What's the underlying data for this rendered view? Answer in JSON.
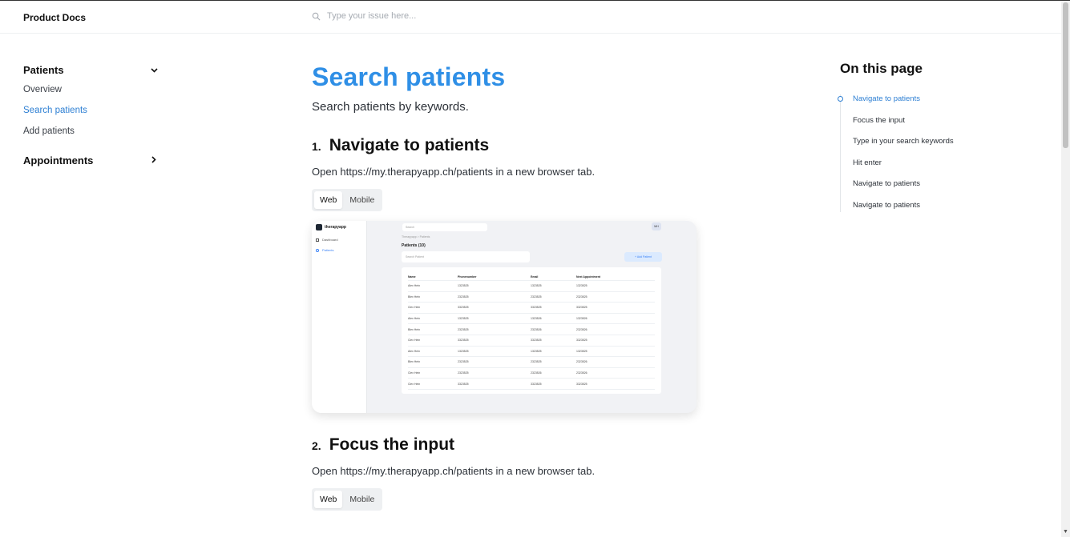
{
  "header": {
    "brand": "Product Docs",
    "search_placeholder": "Type your issue here...",
    "search_icon": "search-icon"
  },
  "sidebar": {
    "sections": [
      {
        "label": "Patients",
        "icon": "chevron-down-icon",
        "items": [
          {
            "label": "Overview",
            "active": false
          },
          {
            "label": "Search patients",
            "active": true
          },
          {
            "label": "Add patients",
            "active": false
          }
        ]
      },
      {
        "label": "Appointments",
        "icon": "chevron-right-icon"
      }
    ]
  },
  "main": {
    "title": "Search patients",
    "subtitle": "Search patients by keywords.",
    "steps": [
      {
        "number": "1.",
        "title": "Navigate to patients",
        "text": "Open https://my.therapyapp.ch/patients in a new browser tab.",
        "tabs": [
          "Web",
          "Mobile"
        ],
        "active_tab": "Web"
      },
      {
        "number": "2.",
        "title": "Focus the input",
        "text": "Open https://my.therapyapp.ch/patients in a new browser tab.",
        "tabs": [
          "Web",
          "Mobile"
        ],
        "active_tab": "Web"
      }
    ]
  },
  "mock_screenshot": {
    "logo": "therapyapp",
    "nav": [
      "Dashboard",
      "Patients"
    ],
    "search": "Search",
    "avatar": "MH",
    "breadcrumb": "Therapyapp  >  Patients",
    "heading": "Patients (10)",
    "search_patient": "Search Patient",
    "add_button": "+  Add Patient",
    "columns": [
      "Name",
      "Phonenumber",
      "Email",
      "Next Appointment"
    ],
    "rows": [
      [
        "Alex Hein",
        "1323525",
        "1323525",
        "1323525"
      ],
      [
        "Blex Hein",
        "2323525",
        "2323525",
        "2323525"
      ],
      [
        "Clex Hein",
        "3323525",
        "3323525",
        "3323525"
      ],
      [
        "Alex Hein",
        "1323525",
        "1323526",
        "1323526"
      ],
      [
        "Blex Hein",
        "2323525",
        "2323526",
        "2323526"
      ],
      [
        "Clex Hein",
        "3323525",
        "3323525",
        "3323525"
      ],
      [
        "Alex Hein",
        "1323525",
        "1323525",
        "1323525"
      ],
      [
        "Blex Hein",
        "2323525",
        "2323525",
        "2323526"
      ],
      [
        "Clex Hein",
        "2323525",
        "2323526",
        "2323526"
      ],
      [
        "Clex Hein",
        "3323525",
        "3323525",
        "3323525"
      ]
    ]
  },
  "toc": {
    "title": "On this page",
    "items": [
      {
        "label": "Navigate to patients",
        "active": true
      },
      {
        "label": "Focus the input",
        "active": false
      },
      {
        "label": "Type in your search keywords",
        "active": false
      },
      {
        "label": "Hit enter",
        "active": false
      },
      {
        "label": "Navigate to patients",
        "active": false
      },
      {
        "label": "Navigate to patients",
        "active": false
      }
    ]
  },
  "colors": {
    "accent": "#2f8fe6",
    "link_active": "#2d7fd3",
    "text": "#2c3138"
  }
}
